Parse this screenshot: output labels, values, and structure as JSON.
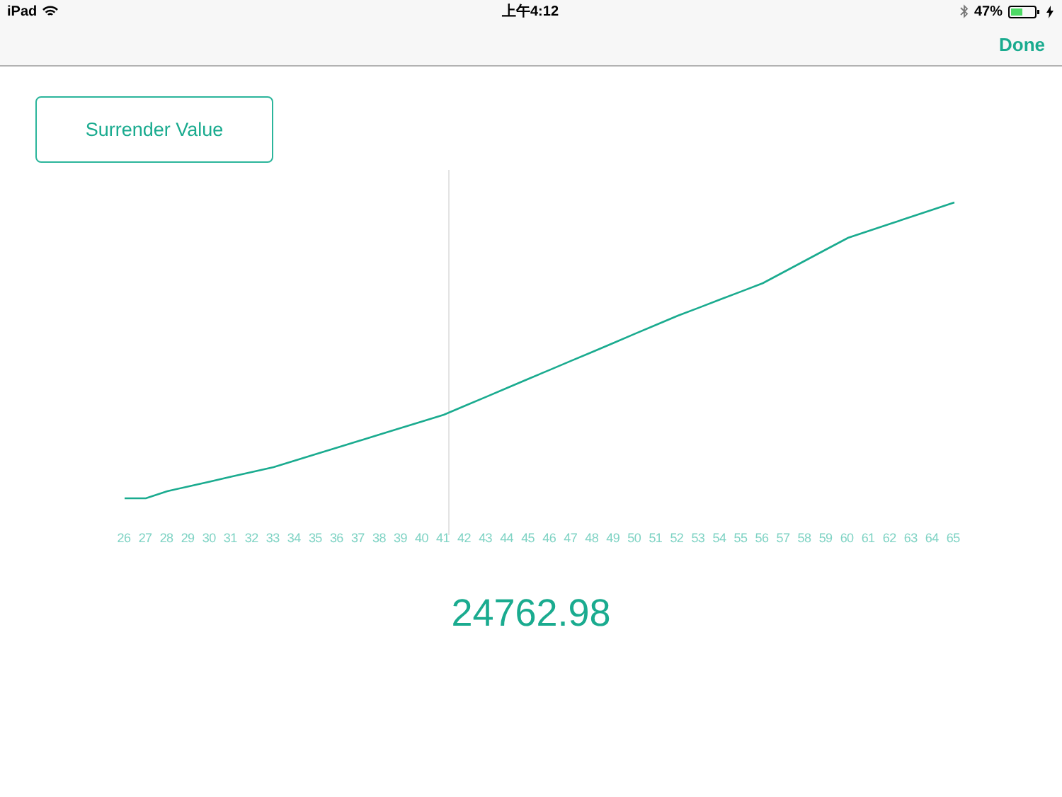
{
  "status_bar": {
    "device": "iPad",
    "time": "上午4:12",
    "battery_percent": "47%"
  },
  "nav_bar": {
    "done_button": "Done"
  },
  "mode_button": "Surrender Value",
  "chart": {
    "x_labels": [
      "26",
      "27",
      "28",
      "29",
      "30",
      "31",
      "32",
      "33",
      "34",
      "35",
      "36",
      "37",
      "38",
      "39",
      "40",
      "41",
      "42",
      "43",
      "44",
      "45",
      "46",
      "47",
      "48",
      "49",
      "50",
      "51",
      "52",
      "53",
      "54",
      "55",
      "56",
      "57",
      "58",
      "59",
      "60",
      "61",
      "62",
      "63",
      "64",
      "65"
    ]
  },
  "value": "24762.98"
}
